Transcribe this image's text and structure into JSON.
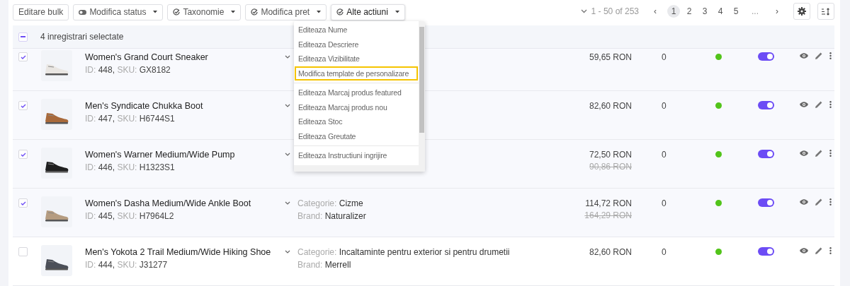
{
  "toolbar": {
    "buttons": [
      {
        "label": "Editare bulk",
        "kind": "plain",
        "open": false
      },
      {
        "label": "Modifica status",
        "kind": "toggle",
        "open": false
      },
      {
        "label": "Taxonomie",
        "kind": "check",
        "open": false
      },
      {
        "label": "Modifica pret",
        "kind": "check",
        "open": false
      },
      {
        "label": "Alte actiuni",
        "kind": "check",
        "open": true
      }
    ]
  },
  "pagination": {
    "range": "1 - 50 of 253",
    "prev": "‹",
    "next": "›",
    "ellipsis": "...",
    "pages": [
      {
        "label": "1",
        "selected": true
      },
      {
        "label": "2",
        "selected": false
      },
      {
        "label": "3",
        "selected": false
      },
      {
        "label": "4",
        "selected": false
      },
      {
        "label": "5",
        "selected": false
      }
    ]
  },
  "dropdown": {
    "groups": [
      [
        {
          "label": "Editeaza Nume",
          "selected": false
        },
        {
          "label": "Editeaza Descriere",
          "selected": false
        },
        {
          "label": "Editeaza Vizibilitate",
          "selected": false
        },
        {
          "label": "Modifica template de personalizare",
          "selected": true
        }
      ],
      [
        {
          "label": "Editeaza Marcaj produs featured",
          "selected": false
        },
        {
          "label": "Editeaza Marcaj produs nou",
          "selected": false
        },
        {
          "label": "Editeaza Stoc",
          "selected": false
        },
        {
          "label": "Editeaza Greutate",
          "selected": false
        }
      ],
      [
        {
          "label": "Editeaza Instructiuni ingrijire",
          "selected": false
        }
      ]
    ]
  },
  "selection": {
    "label": "4 inregistrari selectate",
    "indeterminate": true
  },
  "rows": [
    {
      "checked": true,
      "name": "Women's Grand Court Sneaker",
      "id_label": "ID:",
      "id": "448,",
      "sku_label": "SKU:",
      "sku": "GX8182",
      "price": "59,65 RON",
      "stock": "0",
      "online": true,
      "on": true
    },
    {
      "checked": true,
      "name": "Men's Syndicate Chukka Boot",
      "id_label": "ID:",
      "id": "447,",
      "sku_label": "SKU:",
      "sku": "H6744S1",
      "price": "82,60 RON",
      "stock": "0",
      "online": true,
      "on": true
    },
    {
      "checked": true,
      "name": "Women's Warner Medium/Wide Pump",
      "id_label": "ID:",
      "id": "446,",
      "sku_label": "SKU:",
      "sku": "H1323S1",
      "price": "72,50 RON",
      "old_price": "90,86 RON",
      "stock": "0",
      "online": true,
      "on": true
    },
    {
      "checked": true,
      "name": "Women's Dasha Medium/Wide Ankle Boot",
      "id_label": "ID:",
      "id": "445,",
      "sku_label": "SKU:",
      "sku": "H7964L2",
      "category_label": "Categorie:",
      "category": "Cizme",
      "brand_label": "Brand:",
      "brand": "Naturalizer",
      "price": "114,72 RON",
      "old_price": "164,29 RON",
      "stock": "0",
      "online": true,
      "on": true
    },
    {
      "checked": false,
      "name": "Men's Yokota 2 Trail Medium/Wide Hiking Shoe",
      "id_label": "ID:",
      "id": "444,",
      "sku_label": "SKU:",
      "sku": "J31277",
      "category_label": "Categorie:",
      "category": "Incaltaminte pentru exterior si pentru drumetii",
      "brand_label": "Brand:",
      "brand": "Merrell",
      "price": "82,60 RON",
      "stock": "0",
      "online": true,
      "on": true
    }
  ]
}
